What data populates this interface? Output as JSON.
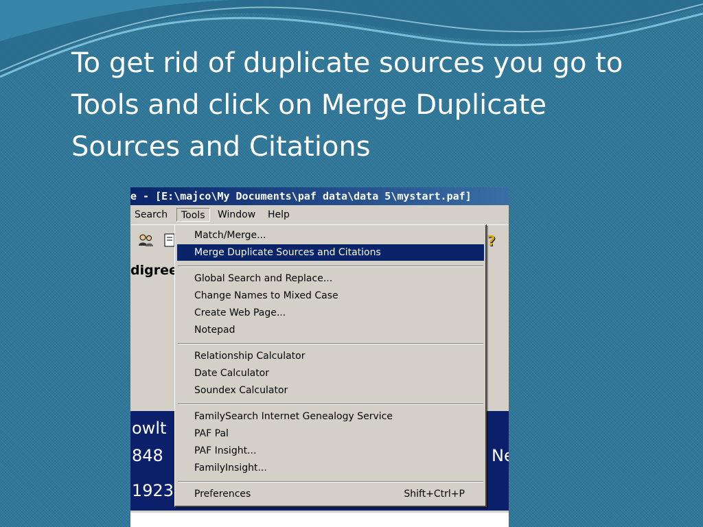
{
  "slide": {
    "title_lines": [
      "To get rid of duplicate sources you go to",
      "Tools and click on Merge Duplicate",
      "Sources and Citations"
    ]
  },
  "window": {
    "title": "e - [E:\\majco\\My Documents\\paf data\\data 5\\mystart.paf]"
  },
  "menubar": {
    "items": [
      "Search",
      "Tools",
      "Window",
      "Help"
    ],
    "open_menu": "Tools"
  },
  "toolbar": {
    "icons": [
      "users-icon",
      "notebook-icon",
      "help-icon"
    ],
    "help_glyph": "?"
  },
  "view": {
    "pedigree_label": "digree"
  },
  "navy_panel": {
    "line1": "owlt",
    "line2": "848",
    "line3": "1923",
    "right_fragment": "Ne"
  },
  "tools_menu": {
    "groups": [
      [
        {
          "label": "Match/Merge..."
        },
        {
          "label": "Merge Duplicate Sources and Citations",
          "highlighted": true
        }
      ],
      [
        {
          "label": "Global Search and Replace..."
        },
        {
          "label": "Change Names to Mixed Case"
        },
        {
          "label": "Create Web Page..."
        },
        {
          "label": "Notepad"
        }
      ],
      [
        {
          "label": "Relationship Calculator"
        },
        {
          "label": "Date Calculator"
        },
        {
          "label": "Soundex Calculator"
        }
      ],
      [
        {
          "label": "FamilySearch Internet Genealogy Service"
        },
        {
          "label": "PAF Pal"
        },
        {
          "label": "PAF Insight..."
        },
        {
          "label": "FamilyInsight..."
        }
      ],
      [
        {
          "label": "Preferences",
          "shortcut": "Shift+Ctrl+P"
        }
      ]
    ]
  },
  "colors": {
    "slide_bg": "#2f7799",
    "titlebar": "#0a246a",
    "highlight": "#0a246a",
    "navy_panel": "#0c1f6b",
    "menu_bg": "#d4d0c8"
  }
}
